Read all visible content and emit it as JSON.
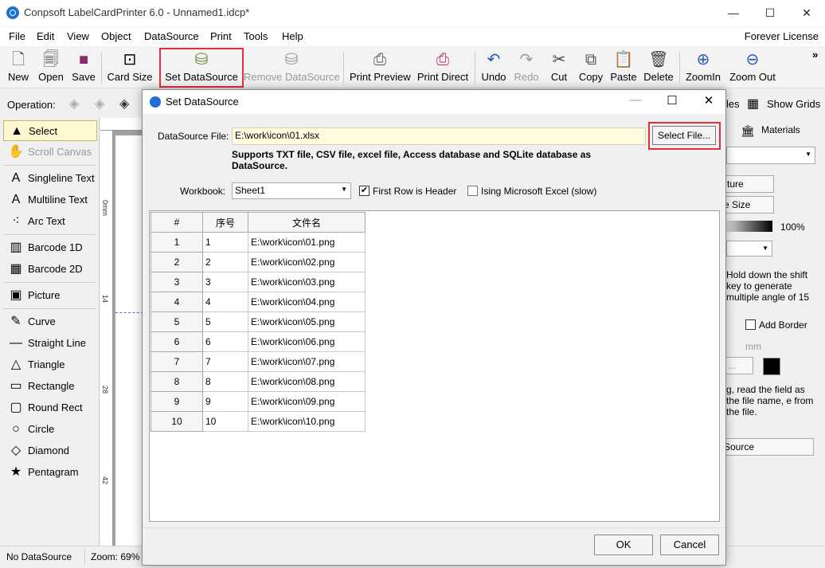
{
  "window": {
    "title": "Conpsoft LabelCardPrinter 6.0 - Unnamed1.idcp*",
    "minimize": "—",
    "maximize": "☐",
    "close": "✕"
  },
  "menu": {
    "items": [
      "File",
      "Edit",
      "View",
      "Object",
      "DataSource",
      "Print",
      "Tools",
      "Help"
    ],
    "license": "Forever License"
  },
  "toolbar": {
    "new": "New",
    "open": "Open",
    "save": "Save",
    "card_size": "Card Size",
    "set_datasource": "Set DataSource",
    "remove_datasource": "Remove DataSource",
    "print_preview": "Print Preview",
    "print_direct": "Print Direct",
    "undo": "Undo",
    "redo": "Redo",
    "cut": "Cut",
    "copy": "Copy",
    "paste": "Paste",
    "delete": "Delete",
    "zoomin": "ZoomIn",
    "zoomout": "Zoom Out",
    "more": "»"
  },
  "operation": {
    "label": "Operation:",
    "show_grids": "Show Grids",
    "tab_partial": "les",
    "materials": "Materials"
  },
  "tools": [
    {
      "label": "Select",
      "icon": "▲"
    },
    {
      "label": "Scroll Canvas",
      "icon": "✋"
    },
    {
      "label": "Singleline Text",
      "icon": "A"
    },
    {
      "label": "Multiline Text",
      "icon": "A"
    },
    {
      "label": "Arc Text",
      "icon": "⁖"
    },
    {
      "label": "Barcode 1D",
      "icon": "▥"
    },
    {
      "label": "Barcode 2D",
      "icon": "▦"
    },
    {
      "label": "Picture",
      "icon": "▣"
    },
    {
      "label": "Curve",
      "icon": "✎"
    },
    {
      "label": "Straight Line",
      "icon": "—"
    },
    {
      "label": "Triangle",
      "icon": "△"
    },
    {
      "label": "Rectangle",
      "icon": "▭"
    },
    {
      "label": "Round Rect",
      "icon": "▢"
    },
    {
      "label": "Circle",
      "icon": "○"
    },
    {
      "label": "Diamond",
      "icon": "◇"
    },
    {
      "label": "Pentagram",
      "icon": "★"
    }
  ],
  "ruler": {
    "marks": [
      "0mm",
      "14",
      "28",
      "42"
    ]
  },
  "right_panel": {
    "btn_picture": "ture",
    "btn_size": "e Size",
    "percent": "100%",
    "hint": "Hold down the shift key to generate multiple angle of 15",
    "add_border": "Add Border",
    "unit": "mm",
    "color_btn": "r ...",
    "datasource_note": "g, read the field as the file name, e from the file.",
    "datasource_btn": "Source"
  },
  "status": {
    "datasource": "No DataSource",
    "zoom": "Zoom: 69%"
  },
  "dialog": {
    "title": "Set DataSource",
    "minimize": "—",
    "maximize": "☐",
    "close": "✕",
    "datasource_label": "DataSource File:",
    "datasource_value": "E:\\work\\icon\\01.xlsx",
    "select_file": "Select File...",
    "supports": "Supports TXT file, CSV file, excel file, Access database and SQLite database as DataSource.",
    "workbook_label": "Workbook:",
    "workbook_value": "Sheet1",
    "first_row_header": "First Row is Header",
    "first_row_checked": "✔",
    "using_excel": "Ising Microsoft Excel (slow)",
    "ok": "OK",
    "cancel": "Cancel"
  },
  "grid": {
    "headers": [
      "#",
      "序号",
      "文件名"
    ],
    "rows": [
      [
        "1",
        "1",
        "E:\\work\\icon\\01.png"
      ],
      [
        "2",
        "2",
        "E:\\work\\icon\\02.png"
      ],
      [
        "3",
        "3",
        "E:\\work\\icon\\03.png"
      ],
      [
        "4",
        "4",
        "E:\\work\\icon\\04.png"
      ],
      [
        "5",
        "5",
        "E:\\work\\icon\\05.png"
      ],
      [
        "6",
        "6",
        "E:\\work\\icon\\06.png"
      ],
      [
        "7",
        "7",
        "E:\\work\\icon\\07.png"
      ],
      [
        "8",
        "8",
        "E:\\work\\icon\\08.png"
      ],
      [
        "9",
        "9",
        "E:\\work\\icon\\09.png"
      ],
      [
        "10",
        "10",
        "E:\\work\\icon\\10.png"
      ]
    ]
  },
  "colors": {
    "accent": "#1e6fd9",
    "highlight_frame": "#e0303a",
    "input_bg": "#fffbe0"
  }
}
